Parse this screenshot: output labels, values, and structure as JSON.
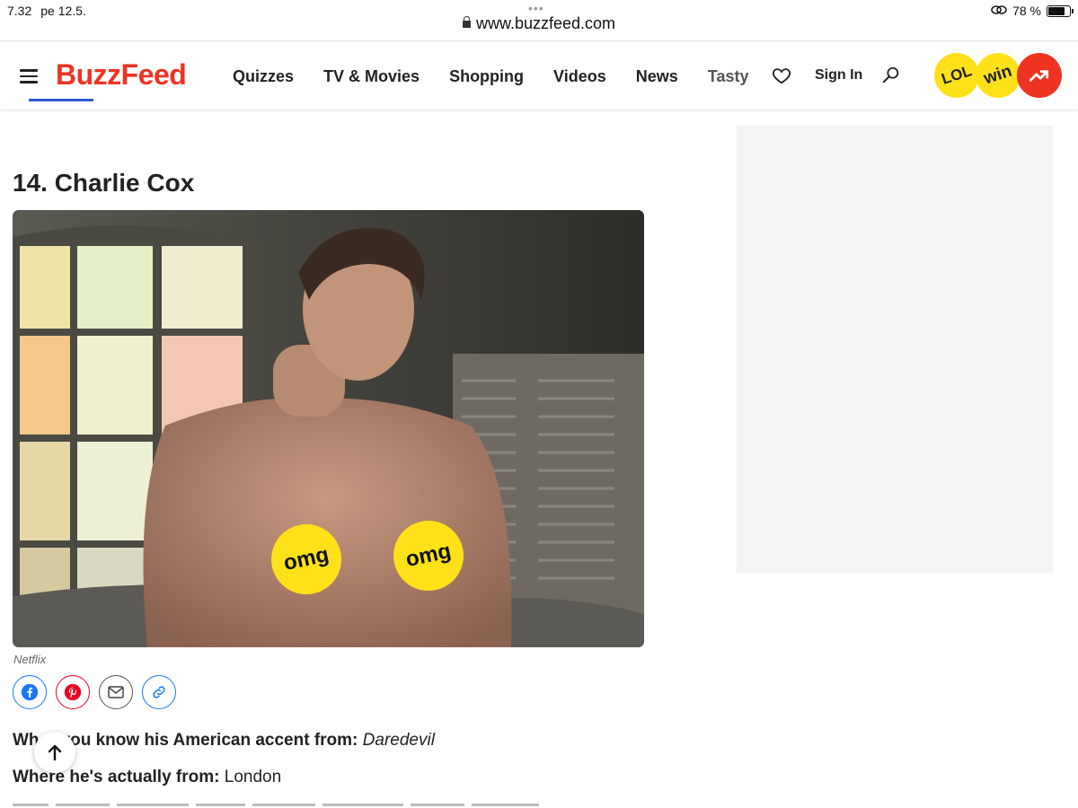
{
  "status": {
    "time": "7.32",
    "date": "pe 12.5.",
    "url": "www.buzzfeed.com",
    "battery_percent_label": "78 %",
    "battery_level": 0.78
  },
  "header": {
    "logo": "BuzzFeed",
    "nav": [
      "Quizzes",
      "TV & Movies",
      "Shopping",
      "Videos",
      "News",
      "Tasty"
    ],
    "sign_in": "Sign In",
    "badges": {
      "lol": "LOL",
      "win": "win"
    },
    "icons": [
      "hamburger-icon",
      "heart-icon",
      "search-icon",
      "trending-arrow-icon"
    ]
  },
  "article": {
    "heading": "14. Charlie Cox",
    "photo_stickers": [
      "omg",
      "omg"
    ],
    "credit": "Netflix",
    "share_icons": [
      "facebook-icon",
      "pinterest-icon",
      "email-icon",
      "link-icon"
    ],
    "line1": {
      "label": "Wh",
      "label_rest": "you know his American accent from:",
      "value": "Daredevil"
    },
    "line2": {
      "label": "Where he's actually from:",
      "value": "London"
    }
  },
  "colors": {
    "brand_red": "#ee3322",
    "badge_yellow": "#ffe11a",
    "link_blue": "#1877f2",
    "pinterest_red": "#e60023"
  }
}
